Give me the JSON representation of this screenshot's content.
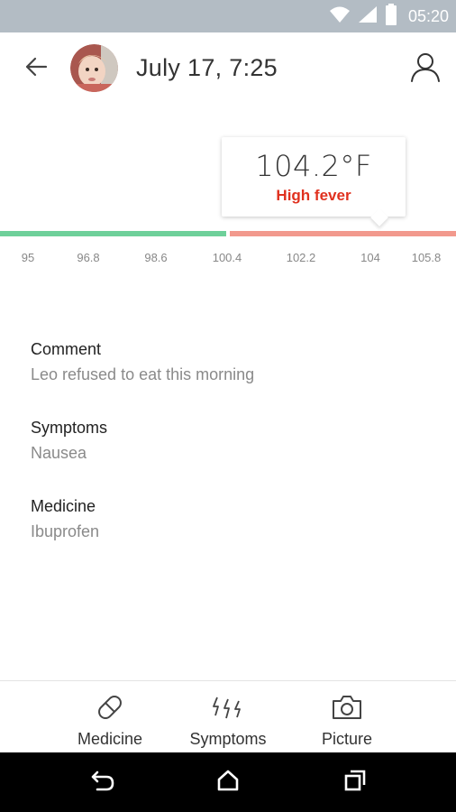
{
  "status_bar": {
    "time": "05:20",
    "icons": [
      "wifi-icon",
      "signal-icon",
      "battery-icon"
    ]
  },
  "header": {
    "date_label": "July 17,  7:25",
    "back_icon": "arrow-left-icon",
    "profile_icon": "person-outline-icon"
  },
  "reading": {
    "temperature": "104.2°F",
    "status": "High fever",
    "status_color": "#e0311f",
    "normal_color": "#6ed09a",
    "fever_color": "#f2998d"
  },
  "scale": {
    "ticks": [
      "95",
      "96.8",
      "98.6",
      "100.4",
      "102.2",
      "104",
      "105.8"
    ]
  },
  "details": {
    "comment": {
      "label": "Comment",
      "value": "Leo refused to eat this morning"
    },
    "symptoms": {
      "label": "Symptoms",
      "value": "Nausea"
    },
    "medicine": {
      "label": "Medicine",
      "value": "Ibuprofen"
    }
  },
  "actions": {
    "medicine": {
      "label": "Medicine",
      "icon": "pill-icon"
    },
    "symptoms": {
      "label": "Symptoms",
      "icon": "lightning-icon"
    },
    "picture": {
      "label": "Picture",
      "icon": "camera-icon"
    }
  },
  "nav": {
    "back": "nav-back-icon",
    "home": "nav-home-icon",
    "recents": "nav-recents-icon"
  }
}
